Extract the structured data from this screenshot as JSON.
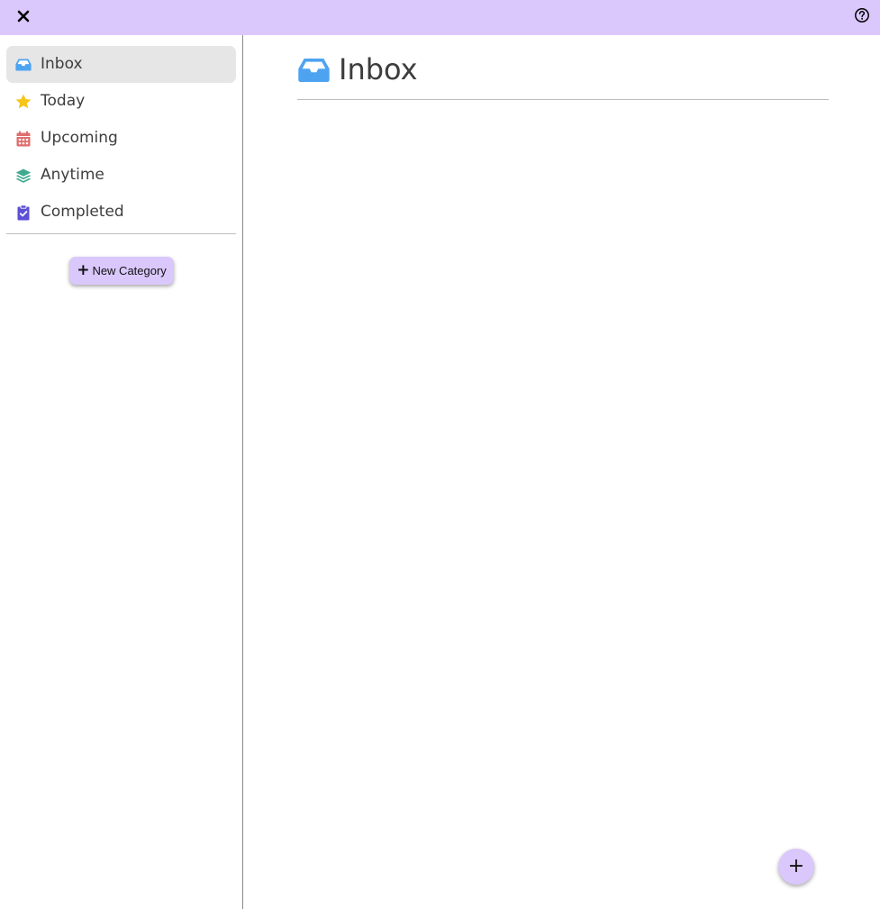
{
  "colors": {
    "accent": "#dac7fb",
    "inbox_icon": "#4ea3f1",
    "today_icon": "#f5c518",
    "upcoming_icon": "#e06d6d",
    "anytime_icon": "#3faa8f",
    "completed_icon": "#5c4fd6"
  },
  "topbar": {
    "close_icon": "close-icon",
    "help_icon": "help-icon"
  },
  "sidebar": {
    "items": [
      {
        "label": "Inbox",
        "icon": "inbox-icon",
        "active": true
      },
      {
        "label": "Today",
        "icon": "star-icon",
        "active": false
      },
      {
        "label": "Upcoming",
        "icon": "calendar-icon",
        "active": false
      },
      {
        "label": "Anytime",
        "icon": "layers-icon",
        "active": false
      },
      {
        "label": "Completed",
        "icon": "clipboard-check-icon",
        "active": false
      }
    ],
    "new_category_label": "New Category"
  },
  "main": {
    "title": "Inbox",
    "title_icon": "inbox-icon"
  },
  "fab": {
    "label": "+"
  }
}
